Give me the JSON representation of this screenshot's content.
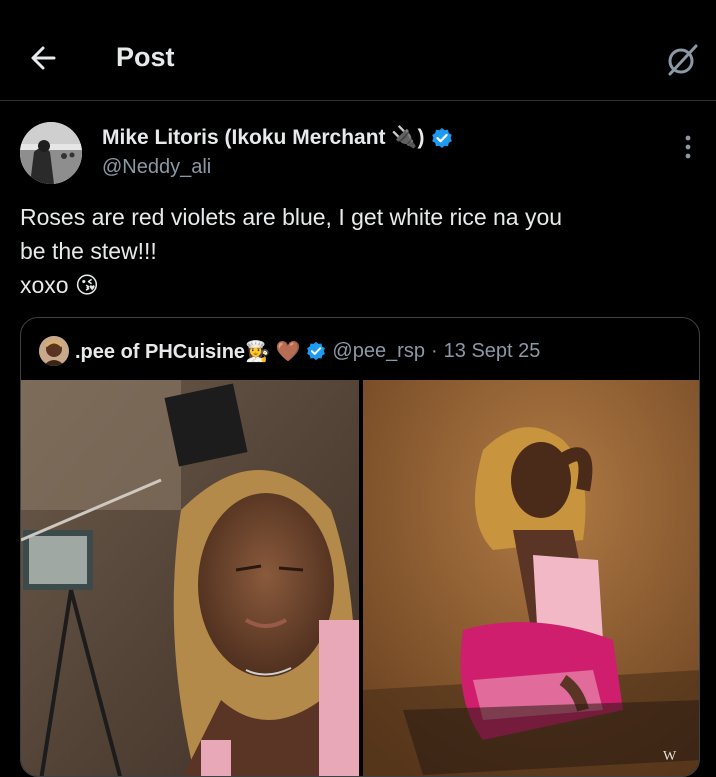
{
  "header": {
    "title": "Post"
  },
  "author": {
    "name": "Mike Litoris (Ikoku Merchant 🔌)",
    "handle": "@Neddy_ali"
  },
  "tweet": {
    "lines": [
      "Roses are red violets are blue, I get white rice na you",
      "be the stew!!!",
      "xoxo 😘"
    ]
  },
  "quote": {
    "name": ".pee of PHCuisine👩‍🍳 🤎",
    "handle": "@pee_rsp",
    "separator": "·",
    "date": "13 Sept 25",
    "watermark": "W"
  },
  "colors": {
    "background": "#000000",
    "text": "#e7e9ea",
    "secondary": "#8b98a5",
    "verified": "#1d9bf0",
    "border": "#2f3336"
  },
  "icons": [
    "back-arrow-icon",
    "grok-icon",
    "verified-badge-icon",
    "more-options-icon"
  ]
}
